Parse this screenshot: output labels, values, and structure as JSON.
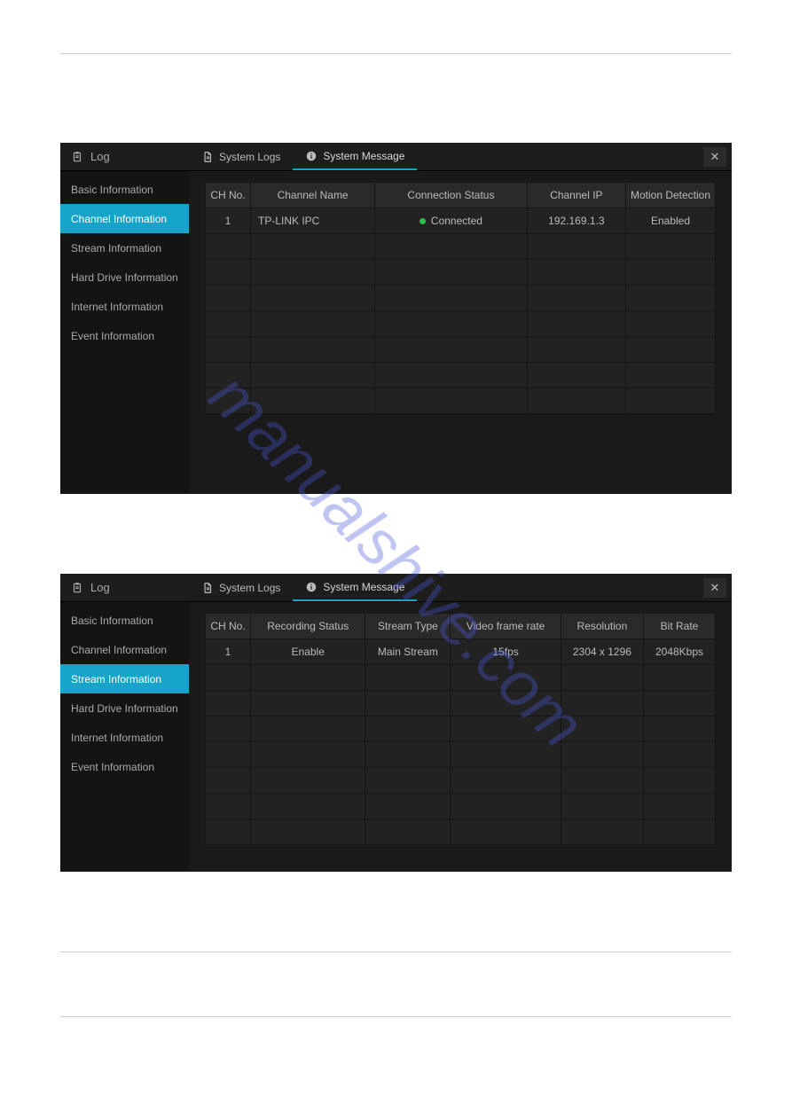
{
  "watermark": "manualshive.com",
  "panels": [
    {
      "title": "Log",
      "tabs": [
        {
          "label": "System Logs",
          "icon": "doc"
        },
        {
          "label": "System Message",
          "icon": "info",
          "active": true
        }
      ],
      "sidebar": [
        {
          "label": "Basic Information"
        },
        {
          "label": "Channel Information",
          "active": true
        },
        {
          "label": "Stream Information"
        },
        {
          "label": "Hard Drive Information"
        },
        {
          "label": "Internet Information"
        },
        {
          "label": "Event Information"
        }
      ],
      "table": {
        "columns": [
          "CH No.",
          "Channel Name",
          "Connection Status",
          "Channel IP",
          "Motion Detection"
        ],
        "col_widths": [
          "50px",
          "",
          "",
          "",
          "100px"
        ],
        "rows": [
          {
            "ch": "1",
            "name": "TP-LINK IPC",
            "status": "Connected",
            "status_dot": "green",
            "ip": "192.169.1.3",
            "motion": "Enabled"
          }
        ],
        "empty_rows": 7
      }
    },
    {
      "title": "Log",
      "tabs": [
        {
          "label": "System Logs",
          "icon": "doc"
        },
        {
          "label": "System Message",
          "icon": "info",
          "active": true
        }
      ],
      "sidebar": [
        {
          "label": "Basic Information"
        },
        {
          "label": "Channel Information"
        },
        {
          "label": "Stream Information",
          "active": true
        },
        {
          "label": "Hard Drive Information"
        },
        {
          "label": "Internet Information"
        },
        {
          "label": "Event Information"
        }
      ],
      "table": {
        "columns": [
          "CH No.",
          "Recording Status",
          "Stream Type",
          "Video frame rate",
          "Resolution",
          "Bit Rate"
        ],
        "col_widths": [
          "50px",
          "",
          "",
          "",
          "",
          ""
        ],
        "rows": [
          {
            "ch": "1",
            "rec": "Enable",
            "stype": "Main Stream",
            "fps": "15fps",
            "res": "2304 x 1296",
            "bitrate": "2048Kbps"
          }
        ],
        "empty_rows": 7
      }
    }
  ]
}
